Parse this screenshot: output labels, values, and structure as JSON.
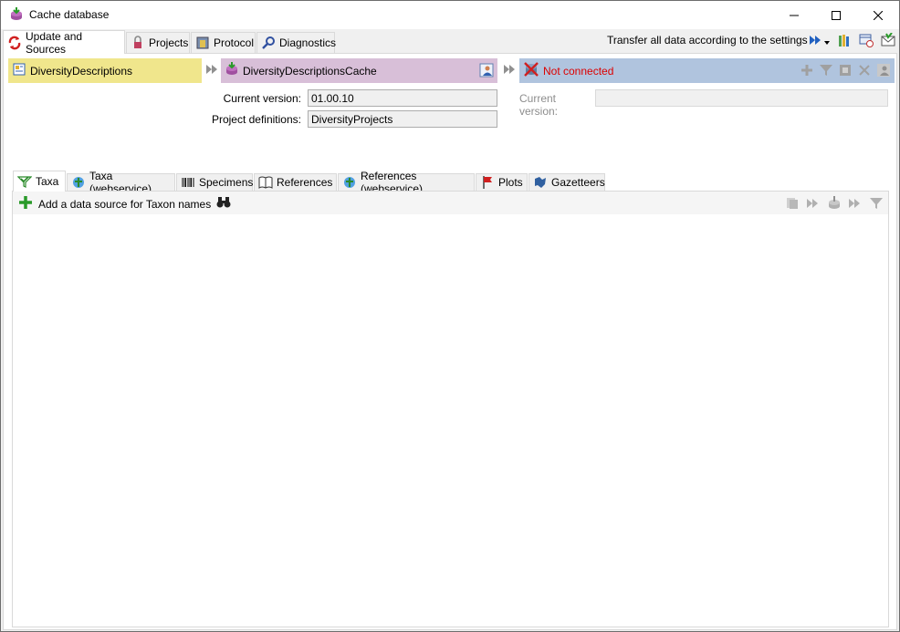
{
  "window": {
    "title": "Cache database",
    "icon": "database-icon"
  },
  "top_tabs": [
    {
      "label": "Update and Sources",
      "icon": "refresh-icon",
      "active": true
    },
    {
      "label": "Projects",
      "icon": "lock-icon",
      "active": false
    },
    {
      "label": "Protocol",
      "icon": "protocol-icon",
      "active": false
    },
    {
      "label": "Diagnostics",
      "icon": "diagnostics-icon",
      "active": false
    }
  ],
  "toolbar": {
    "transfer_label": "Transfer all data according to the settings"
  },
  "sources": {
    "source_db": "DiversityDescriptions",
    "cache_db": "DiversityDescriptionsCache",
    "postgres_status": "Not connected"
  },
  "cache_info": {
    "current_version_label": "Current version:",
    "current_version": "01.00.10",
    "project_definitions_label": "Project definitions:",
    "project_definitions": "DiversityProjects"
  },
  "postgres_info": {
    "current_version_label": "Current version:",
    "current_version": ""
  },
  "inner_tabs": [
    {
      "label": "Taxa",
      "icon": "taxa-icon",
      "active": true
    },
    {
      "label": "Taxa (webservice)",
      "icon": "webservice-icon",
      "active": false
    },
    {
      "label": "Specimens",
      "icon": "barcode-icon",
      "active": false
    },
    {
      "label": "References",
      "icon": "book-icon",
      "active": false
    },
    {
      "label": "References (webservice)",
      "icon": "webservice-icon",
      "active": false
    },
    {
      "label": "Plots",
      "icon": "plot-icon",
      "active": false
    },
    {
      "label": "Gazetteers",
      "icon": "gazetteer-icon",
      "active": false
    }
  ],
  "taxa_panel": {
    "add_source_label": "Add a data source for Taxon names"
  },
  "colors": {
    "source_bar": "#f0e68c",
    "cache_bar": "#d8bfd8",
    "postgres_bar": "#b0c4de",
    "not_connected": "#dc0000"
  }
}
